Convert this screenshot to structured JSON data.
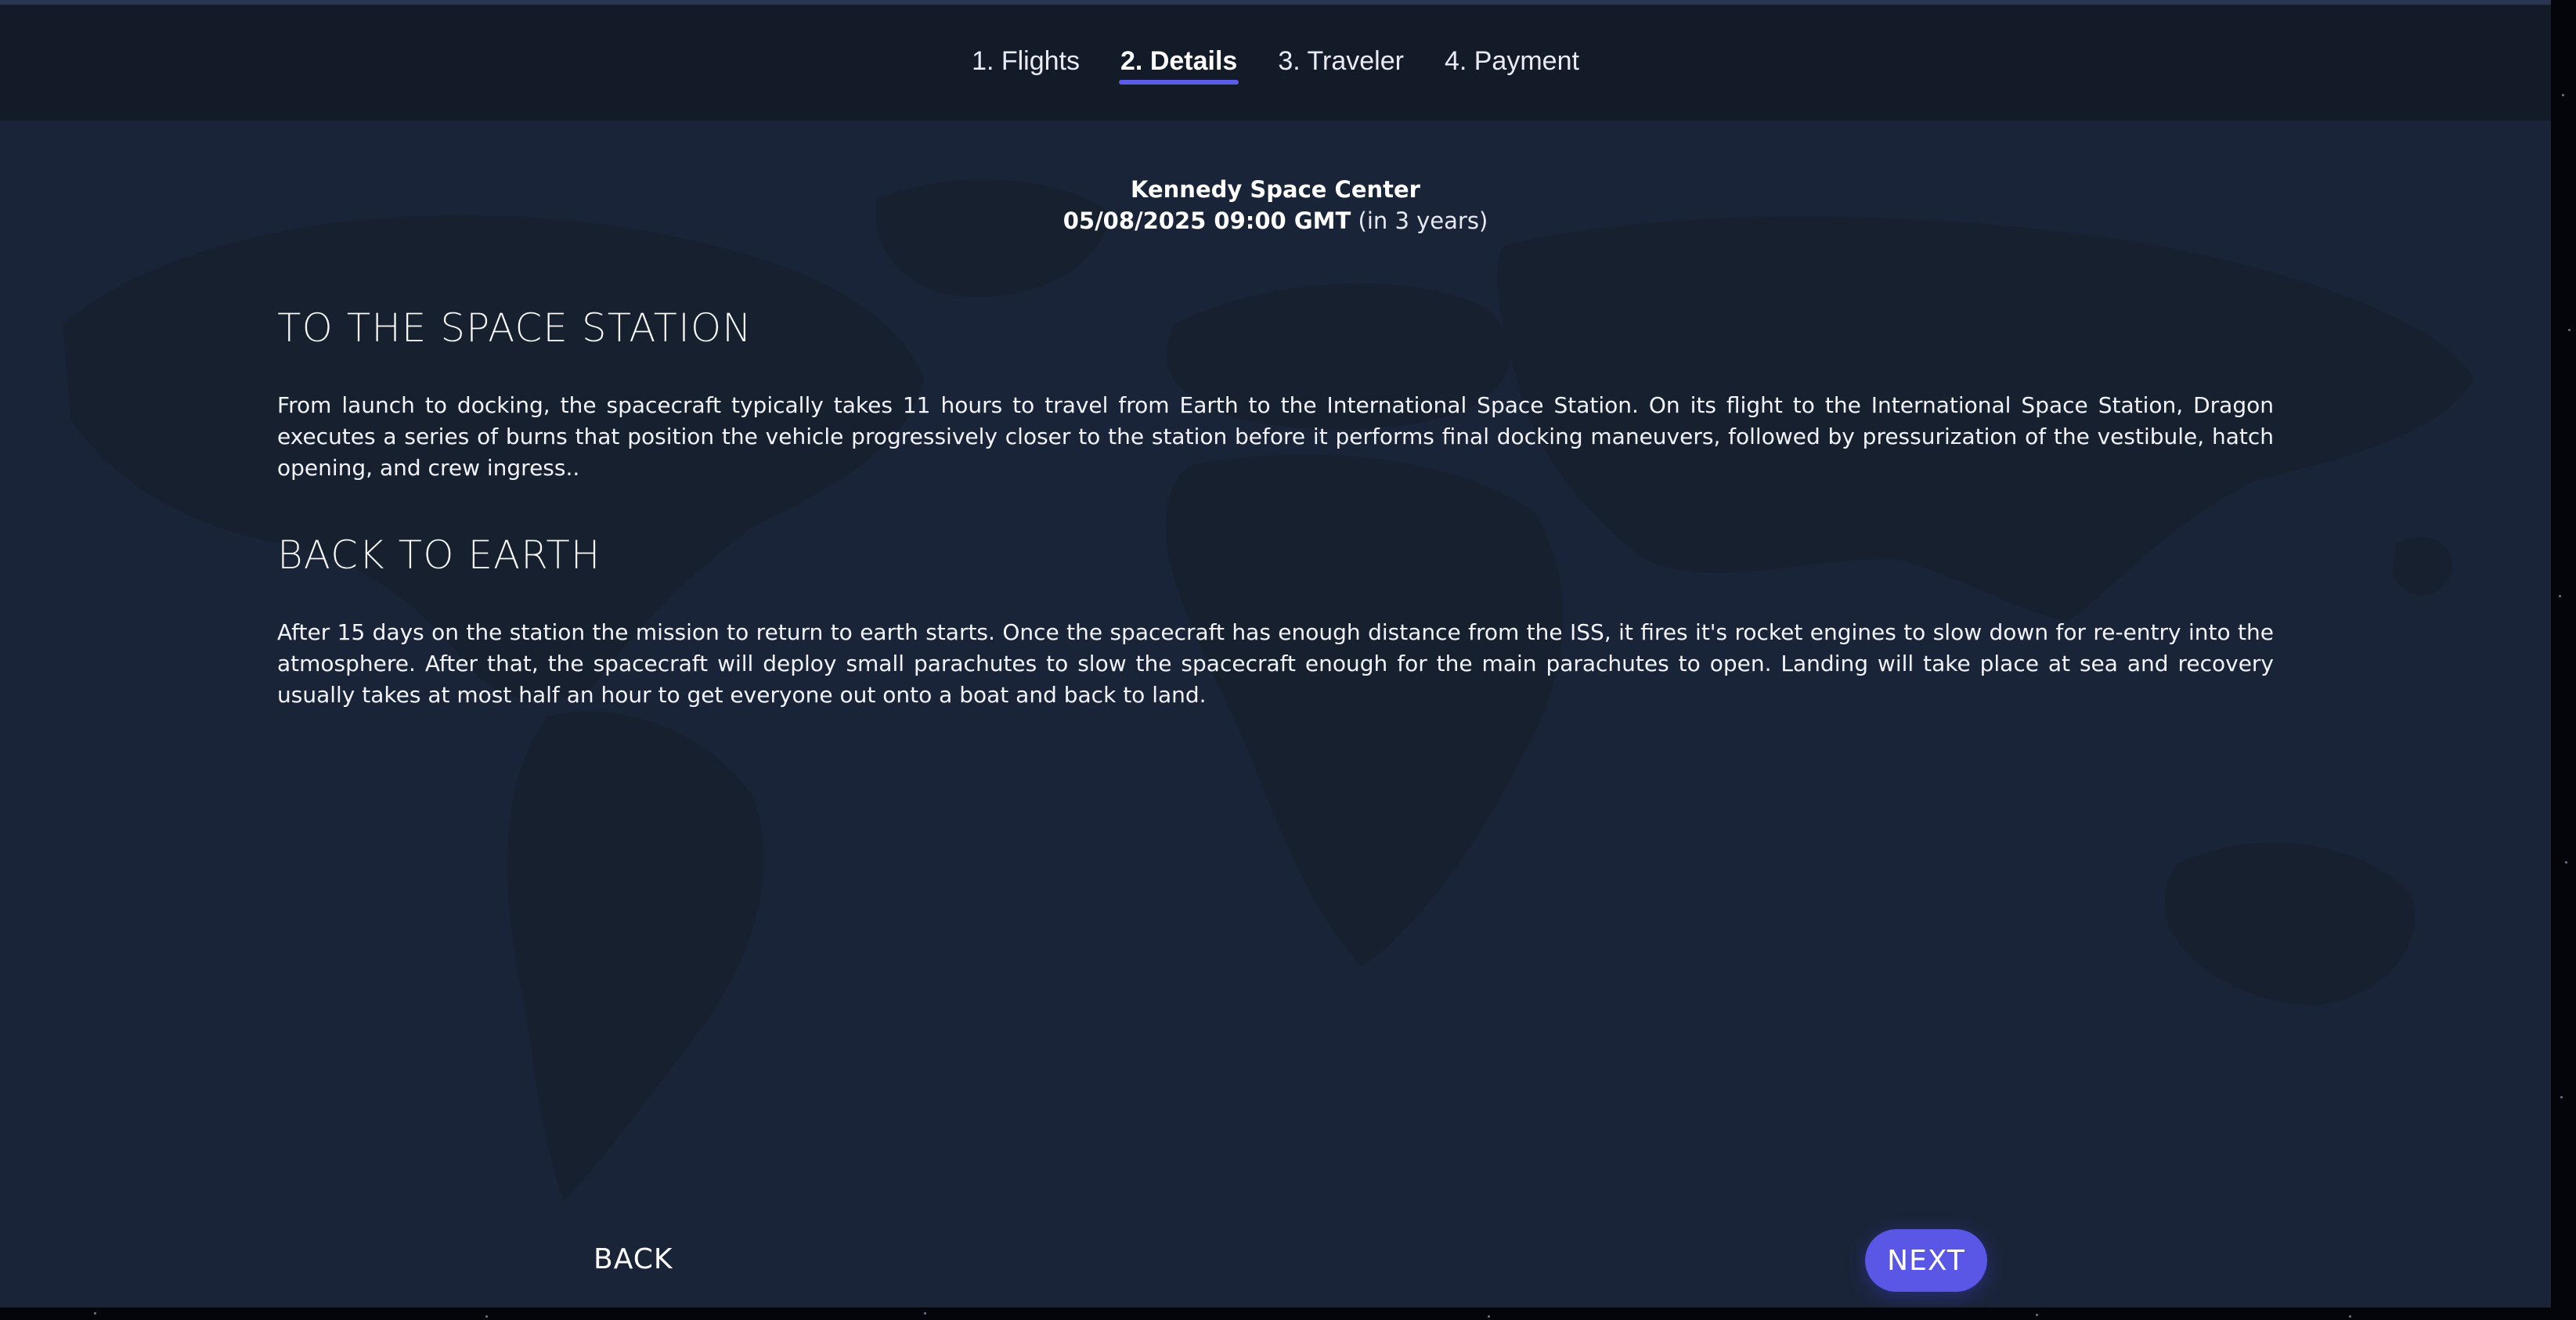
{
  "steps": [
    {
      "label": "1. Flights",
      "active": false
    },
    {
      "label": "2. Details",
      "active": true
    },
    {
      "label": "3. Traveler",
      "active": false
    },
    {
      "label": "4. Payment",
      "active": false
    }
  ],
  "launch": {
    "site": "Kennedy Space Center",
    "datetime": "05/08/2025 09:00 GMT",
    "relative": "(in 3 years)"
  },
  "sections": [
    {
      "title": "TO THE SPACE STATION",
      "body": "From launch to docking, the spacecraft typically takes 11 hours to travel from Earth to the International Space Station. On its flight to the International Space Station, Dragon executes a series of burns that position the vehicle progressively closer to the station before it performs final docking maneuvers, followed by pressurization of the vestibule, hatch opening, and crew ingress.."
    },
    {
      "title": "BACK TO EARTH",
      "body": "After 15 days on the station the mission to return to earth starts. Once the spacecraft has enough distance from the ISS, it fires it's rocket engines to slow down for re-entry into the atmosphere. After that, the spacecraft will deploy small parachutes to slow the spacecraft enough for the main parachutes to open. Landing will take place at sea and recovery usually takes at most half an hour to get everyone out onto a boat and back to land."
    }
  ],
  "nav": {
    "back_label": "BACK",
    "next_label": "NEXT"
  },
  "colors": {
    "background": "#1a2438",
    "header": "#131a28",
    "accent": "#5a56e6",
    "map": "#16202f"
  }
}
